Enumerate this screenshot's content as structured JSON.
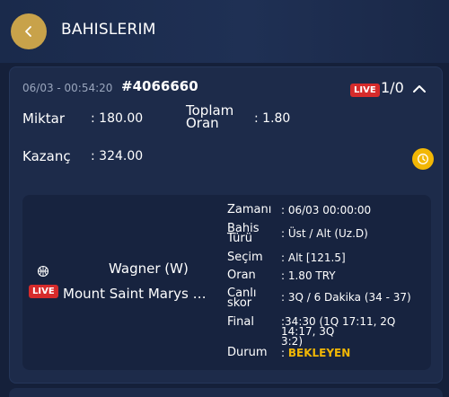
{
  "header": {
    "title": "BAHISLERIM"
  },
  "bet": {
    "datetime": "06/03 - 00:54:20",
    "id": "#4066660",
    "live_label": "LIVE",
    "count": "1/0",
    "amount_label": "Miktar",
    "amount_value": ": 180.00",
    "total_odds_label_1": "Toplam",
    "total_odds_label_2": "Oran",
    "total_odds_value": ": 1.80",
    "win_label": "Kazanç",
    "win_value": ": 324.00"
  },
  "event": {
    "live_label": "LIVE",
    "team_home": "Wagner (W)",
    "team_away": "Mount Saint Marys Mountaineers (W)",
    "rows": {
      "time_label": "Zamanı",
      "time_value": ": 06/03 00:00:00",
      "bet_type_label_1": "Bahis",
      "bet_type_label_2": "Türü",
      "bet_type_value": ": Üst / Alt (Uz.D)",
      "selection_label": "Seçim",
      "selection_value": ": Alt [121.5]",
      "odds_label": "Oran",
      "odds_value": ": 1.80 TRY",
      "live_score_label_1": "Canlı",
      "live_score_label_2": "skor",
      "live_score_value": ": 3Q / 6  Dakika  (34 - 37)",
      "final_label": "Final",
      "final_value_1": ":34:30 (1Q 17:11, 2Q 14:17, 3Q",
      "final_value_2": "3:2)",
      "status_label": "Durum",
      "status_colon": ": ",
      "status_value": "BEKLEYEN"
    }
  },
  "colors": {
    "accent_gold": "#c8a24a",
    "status_yellow": "#f2b705",
    "live_red": "#d62b2b",
    "background": "#15203a"
  },
  "icons": [
    "chevron-left-icon",
    "chevron-up-icon",
    "clock-icon",
    "basketball-icon"
  ]
}
